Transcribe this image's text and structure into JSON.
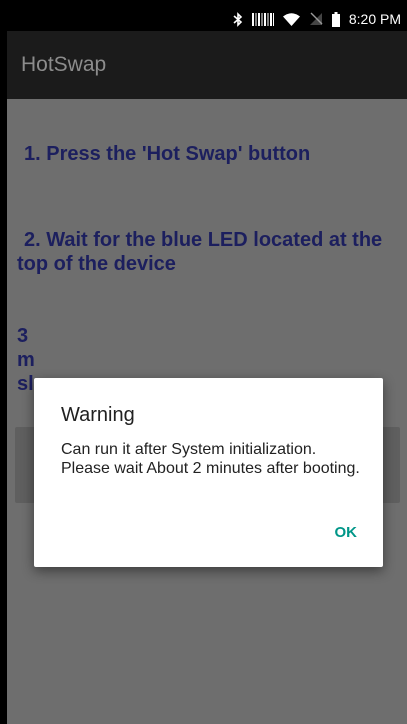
{
  "status_bar": {
    "time": "8:20 PM",
    "icons": [
      "bluetooth-icon",
      "barcode-icon",
      "wifi-icon",
      "no-sim-icon",
      "battery-icon"
    ]
  },
  "app_bar": {
    "title": "HotSwap"
  },
  "steps": {
    "step1": "1. Press the 'Hot Swap' button",
    "step2": "2. Wait for the blue LED located at the top of the device",
    "step3_fragments": [
      "3",
      "m",
      "sl"
    ]
  },
  "dialog": {
    "title": "Warning",
    "message": "Can run it after System initialization. Please wait About 2 minutes after booting.",
    "ok_label": "OK"
  },
  "colors": {
    "app_bar_bg": "#1b1b1b",
    "content_dim_bg": "#6e6e6e",
    "step_text": "#1c1f5e",
    "dialog_accent": "#009688"
  }
}
